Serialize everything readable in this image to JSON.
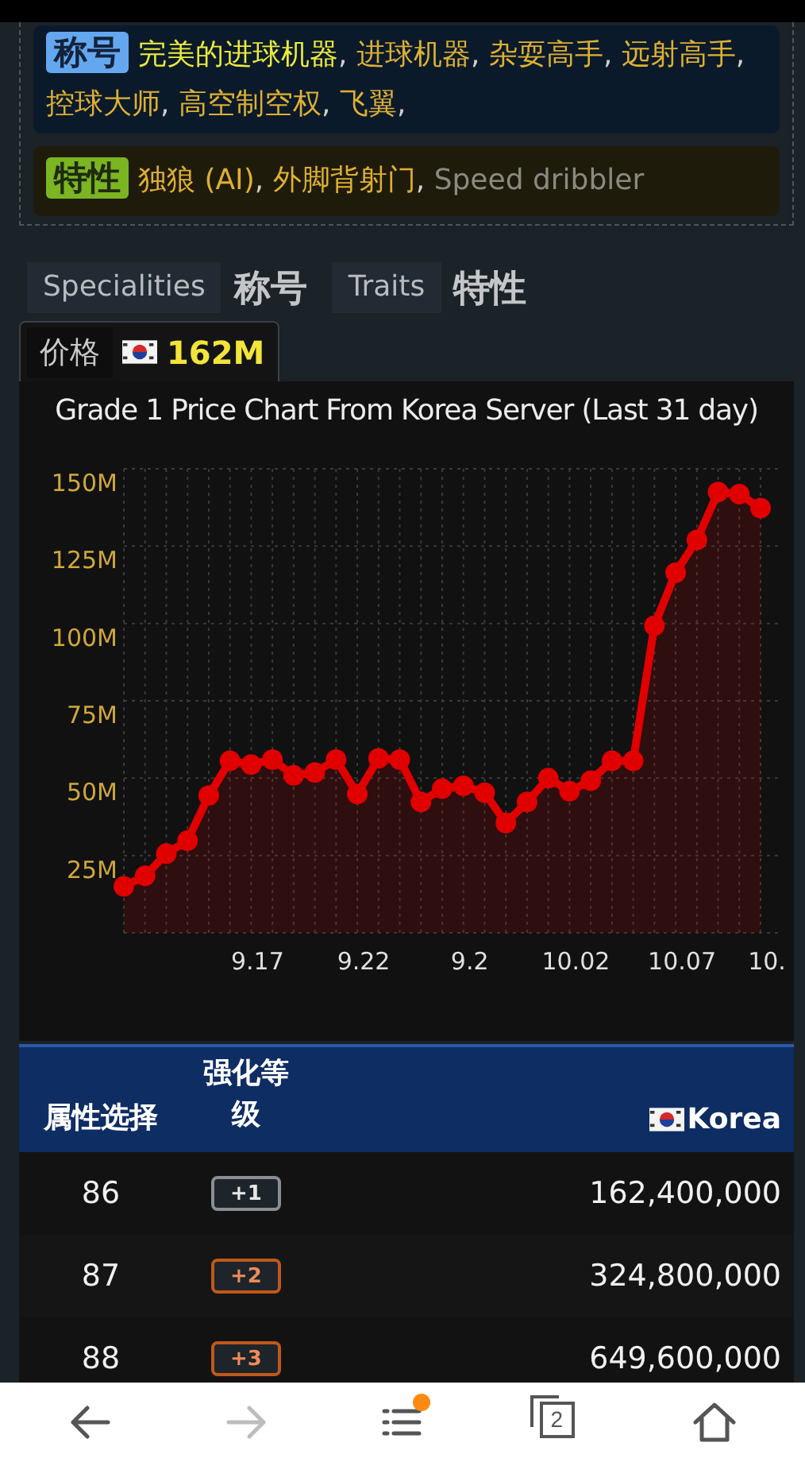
{
  "profile": {
    "titles": {
      "badge": "称号",
      "separator": ",",
      "items": [
        {
          "text": "完美的进球机器",
          "color": "#ecea3c"
        },
        {
          "text": "进球机器",
          "color": "#deb032"
        },
        {
          "text": "杂耍高手",
          "color": "#deb032"
        },
        {
          "text": "远射高手",
          "color": "#deb032"
        },
        {
          "text": "控球大师",
          "color": "#deb032"
        },
        {
          "text": "高空制空权",
          "color": "#deb032"
        },
        {
          "text": "飞翼",
          "color": "#deb032"
        }
      ],
      "trailing": ","
    },
    "traits": {
      "badge": "特性",
      "separator": ",",
      "items": [
        {
          "text": "独狼 (AI)",
          "color": "#deb032"
        },
        {
          "text": "外脚背射门",
          "color": "#deb032"
        },
        {
          "text": "Speed dribbler",
          "color": "#8a8a82"
        }
      ]
    }
  },
  "legend_tabs": [
    {
      "label": "Specialities",
      "caption": "称号"
    },
    {
      "label": "Traits",
      "caption": "特性"
    }
  ],
  "price_tab": {
    "label": "价格",
    "value": "162M",
    "selected": true
  },
  "chart": {
    "title": "Grade 1 Price Chart From Korea Server (Last 31 day)",
    "chart_data": {
      "type": "area",
      "grid": true,
      "categories": [
        null,
        null,
        null,
        null,
        null,
        null,
        "9.17",
        null,
        null,
        null,
        null,
        "9.22",
        null,
        null,
        null,
        null,
        "9.2",
        null,
        null,
        null,
        null,
        "10.02",
        null,
        null,
        null,
        null,
        "10.07",
        null,
        null,
        null,
        "10."
      ],
      "series": [
        {
          "color": "#e00000",
          "values": [
            15,
            18.4,
            25.6,
            29.8,
            44.4,
            55.6,
            54.4,
            56,
            50.9,
            51.8,
            56,
            44.9,
            56.4,
            56,
            42.3,
            46.6,
            47.5,
            45.3,
            35.5,
            42.3,
            50,
            45.8,
            49.2,
            55.6,
            55.6,
            99.3,
            116.4,
            127,
            142.5,
            141.8,
            137.3
          ]
        }
      ],
      "ylim": [
        0,
        150
      ],
      "yticks": [
        {
          "value": 25,
          "label": "25M"
        },
        {
          "value": 50,
          "label": "50M"
        },
        {
          "value": 75,
          "label": "75M"
        },
        {
          "value": 100,
          "label": "100M"
        },
        {
          "value": 125,
          "label": "125M"
        },
        {
          "value": 150,
          "label": "150M"
        }
      ]
    }
  },
  "table": {
    "columns": [
      "属性选择",
      "强化等级",
      "Korea"
    ],
    "rows": [
      {
        "ovr": "86",
        "grade": "+1",
        "kind": "silver",
        "price": "162,400,000"
      },
      {
        "ovr": "87",
        "grade": "+2",
        "kind": "bronze",
        "price": "324,800,000"
      },
      {
        "ovr": "88",
        "grade": "+3",
        "kind": "bronze",
        "price": "649,600,000"
      }
    ]
  },
  "nav": {
    "forward_disabled": true,
    "menu_dot": true,
    "tab_count": "2"
  }
}
